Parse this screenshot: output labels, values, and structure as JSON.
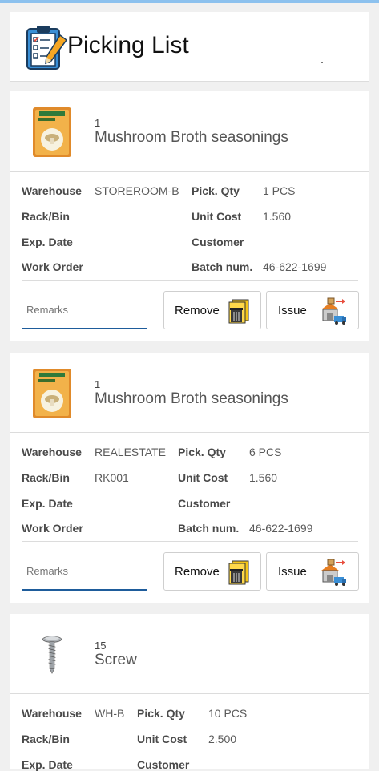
{
  "header": {
    "title": "Picking List",
    "logo_icon": "clipboard-checklist-icon"
  },
  "labels": {
    "warehouse": "Warehouse",
    "rack_bin": "Rack/Bin",
    "exp_date": "Exp. Date",
    "work_order": "Work Order",
    "pick_qty": "Pick. Qty",
    "unit_cost": "Unit Cost",
    "customer": "Customer",
    "batch_num": "Batch num.",
    "remarks_placeholder": "Remarks",
    "remove": "Remove",
    "issue": "Issue"
  },
  "items": [
    {
      "qty": "1",
      "name": "Mushroom Broth seasonings",
      "warehouse": "STOREROOM-B",
      "rack_bin": "",
      "exp_date": "",
      "work_order": "",
      "pick_qty": "1 PCS",
      "unit_cost": "1.560",
      "customer": "",
      "batch_num": "46-622-1699",
      "image": "seasoning-pack"
    },
    {
      "qty": "1",
      "name": "Mushroom Broth seasonings",
      "warehouse": "REALESTATE",
      "rack_bin": "RK001",
      "exp_date": "",
      "work_order": "",
      "pick_qty": "6 PCS",
      "unit_cost": "1.560",
      "customer": "",
      "batch_num": "46-622-1699",
      "image": "seasoning-pack"
    },
    {
      "qty": "15",
      "name": "Screw",
      "warehouse": "WH-B",
      "rack_bin": "",
      "exp_date": "",
      "pick_qty": "10 PCS",
      "unit_cost": "2.500",
      "customer": "",
      "image": "screw"
    }
  ]
}
